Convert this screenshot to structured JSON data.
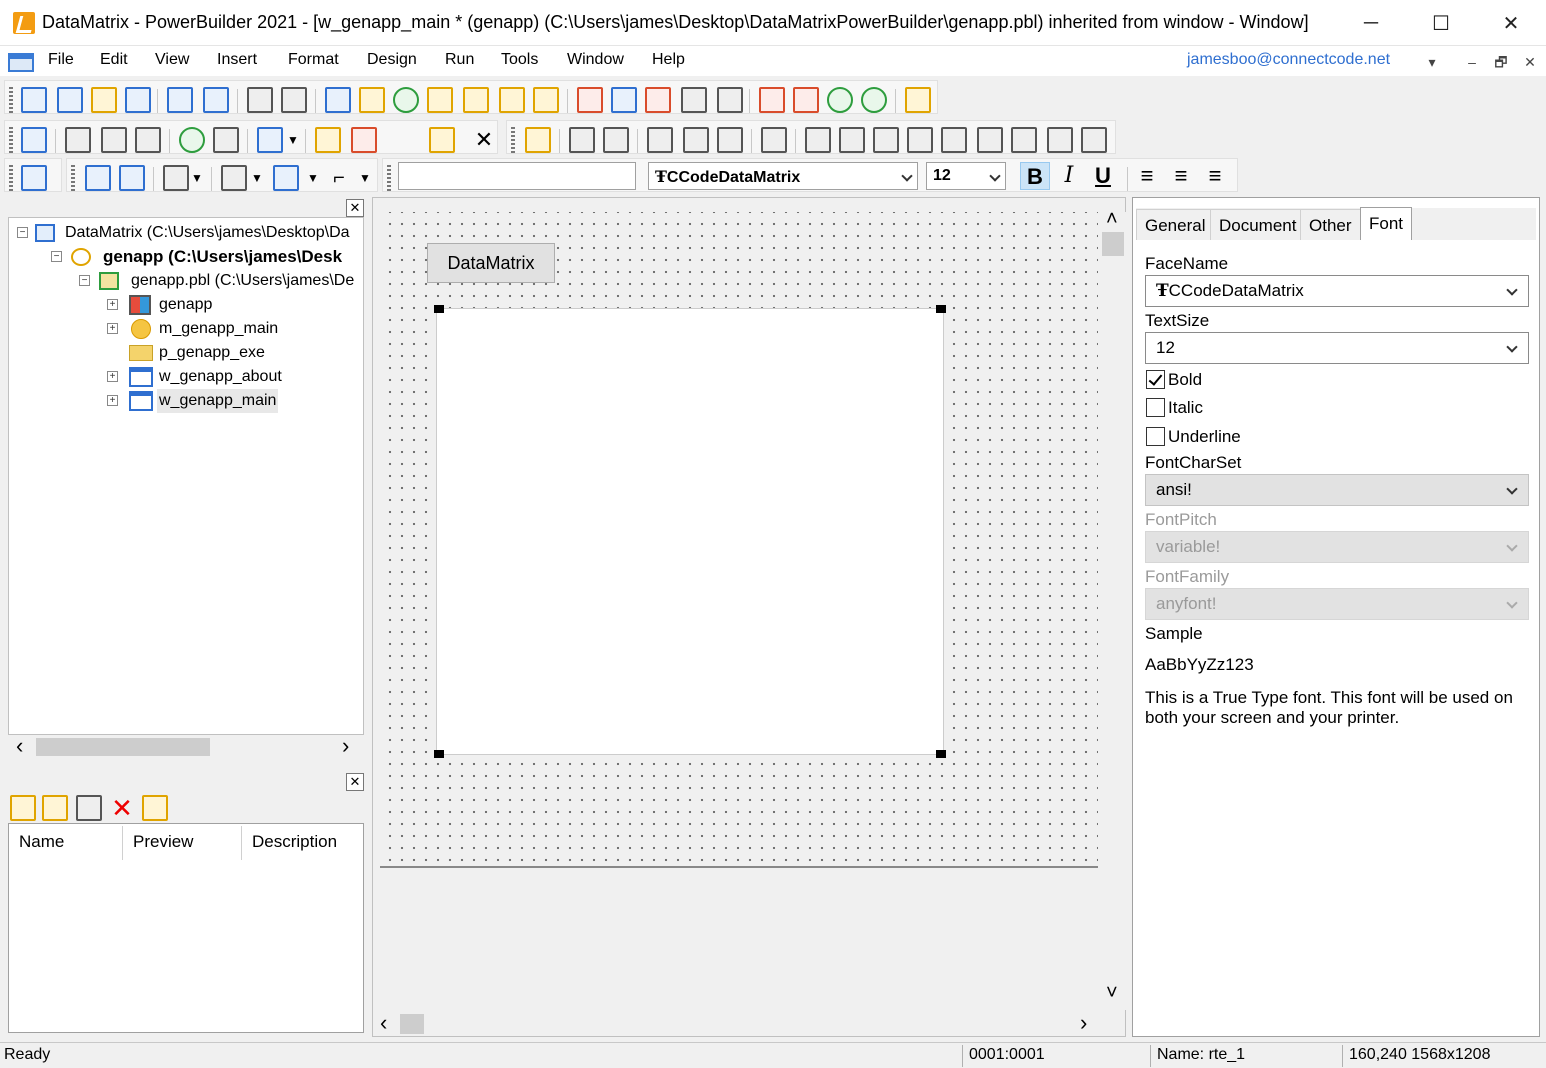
{
  "window": {
    "title": "DataMatrix - PowerBuilder 2021 - [w_genapp_main * (genapp) (C:\\Users\\james\\Desktop\\DataMatrixPowerBuilder\\genapp.pbl) inherited from window - Window]",
    "minimize": "─",
    "maximize": "☐",
    "close": "✕"
  },
  "menu": {
    "items": [
      "File",
      "Edit",
      "View",
      "Insert",
      "Format",
      "Design",
      "Run",
      "Tools",
      "Window",
      "Help"
    ],
    "user_email": "jamesboo@connectcode.net",
    "mdi_dropdown": "▾",
    "mdi_minimize": "–",
    "mdi_restore": "🗗",
    "mdi_close": "✕"
  },
  "font_toolbar": {
    "face": "CCodeDataMatrix",
    "size": "12",
    "bold": "B",
    "italic": "I",
    "underline": "U"
  },
  "tree": {
    "close": "✕",
    "nodes": [
      {
        "label": "DataMatrix (C:\\Users\\james\\Desktop\\Da",
        "expander": "−",
        "bold": false
      },
      {
        "label": "genapp (C:\\Users\\james\\Desk",
        "expander": "−",
        "bold": true
      },
      {
        "label": "genapp.pbl (C:\\Users\\james\\De",
        "expander": "−",
        "bold": false
      },
      {
        "label": "genapp",
        "expander": "+",
        "bold": false
      },
      {
        "label": "m_genapp_main",
        "expander": "+",
        "bold": false
      },
      {
        "label": "p_genapp_exe",
        "expander": "",
        "bold": false
      },
      {
        "label": "w_genapp_about",
        "expander": "+",
        "bold": false
      },
      {
        "label": "w_genapp_main",
        "expander": "+",
        "bold": false
      }
    ],
    "scroll_left": "‹",
    "scroll_right": "›"
  },
  "lower_panel": {
    "close": "✕",
    "columns": [
      "Name",
      "Preview",
      "Description"
    ]
  },
  "canvas": {
    "button_label": "DataMatrix",
    "scroll_up": "˄",
    "scroll_down": "˅",
    "scroll_left": "‹",
    "scroll_right": "›"
  },
  "properties": {
    "tabs": [
      "General",
      "Document",
      "Other",
      "Font"
    ],
    "active_tab": "Font",
    "facename_label": "FaceName",
    "facename_value": "CCodeDataMatrix",
    "textsize_label": "TextSize",
    "textsize_value": "12",
    "bold_label": "Bold",
    "bold_checked": true,
    "italic_label": "Italic",
    "italic_checked": false,
    "underline_label": "Underline",
    "underline_checked": false,
    "fontcharset_label": "FontCharSet",
    "fontcharset_value": "ansi!",
    "fontpitch_label": "FontPitch",
    "fontpitch_value": "variable!",
    "fontfamily_label": "FontFamily",
    "fontfamily_value": "anyfont!",
    "sample_label": "Sample",
    "sample_text": "AaBbYyZz123",
    "description_line1": "This is a True Type font. This font will be used on",
    "description_line2": "both your screen and your printer."
  },
  "status": {
    "ready": "Ready",
    "position": "0001:0001",
    "name": "Name: rte_1",
    "geometry": "160,240 1568x1208"
  }
}
